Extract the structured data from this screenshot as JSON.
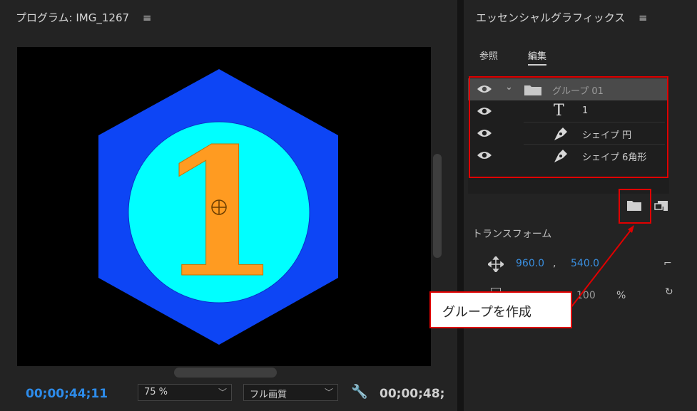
{
  "program_panel": {
    "title": "プログラム: IMG_1267",
    "menu_icon": "hamburger-icon",
    "canvas": {
      "background": "#000000",
      "hexagon_color": "#0d45f5",
      "circle_color": "#00ffff",
      "numeral": "1",
      "numeral_color": "#ff9b21"
    },
    "timecode_current": "00;00;44;11",
    "zoom": "75 %",
    "quality": "フル画質",
    "settings_icon": "wrench-icon",
    "timecode_duration": "00;00;48;"
  },
  "essential_graphics": {
    "title": "エッセンシャルグラフィックス",
    "menu_icon": "hamburger-icon",
    "tabs": [
      "参照",
      "編集"
    ],
    "active_tab": "編集",
    "layers": [
      {
        "name": "グループ 01",
        "type": "group",
        "selected": true
      },
      {
        "name": "1",
        "type": "text"
      },
      {
        "name": "シェイプ 円",
        "type": "shape"
      },
      {
        "name": "シェイプ 6角形",
        "type": "shape"
      }
    ],
    "transform": {
      "label": "トランスフォーム",
      "position_x": "960.0",
      "position_sep": ",",
      "position_y": "540.0",
      "scale": "100",
      "scale_unit": "%"
    }
  },
  "annotation": {
    "callout_text": "グループを作成",
    "highlight_color": "#e00000"
  }
}
